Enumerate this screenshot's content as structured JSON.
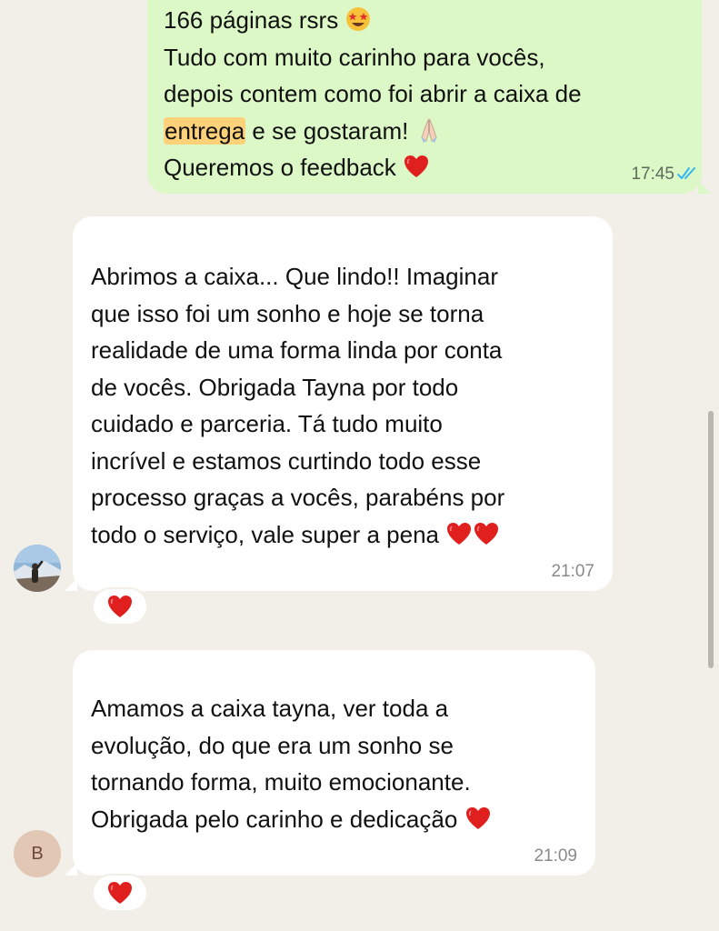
{
  "outgoing_message": {
    "lines": [
      {
        "text": "166 páginas rsrs ",
        "emoji": "star-struck-emoji"
      },
      {
        "text": "Tudo com muito carinho para vocês,"
      },
      {
        "text": "depois contem como foi abrir a caixa de"
      },
      {
        "highlight": "entrega",
        "text": " e se gostaram! ",
        "emoji": "folded-hands-emoji"
      },
      {
        "text": "Queremos o feedback ",
        "emoji": "red-heart-emoji"
      }
    ],
    "time": "17:45",
    "status_icon": "double-check-read-icon"
  },
  "incoming_messages": [
    {
      "lines": [
        "Abrimos a caixa... Que lindo!! Imaginar",
        "que isso foi um sonho e hoje se torna",
        "realidade de uma forma linda por conta",
        "de vocês. Obrigada Tayna por todo",
        "cuidado e parceria. Tá tudo muito",
        "incrível e estamos curtindo todo esse",
        "processo graças a vocês, parabéns por",
        "todo o serviço, vale super a pena "
      ],
      "trailing_emojis": [
        "red-heart-emoji",
        "red-heart-emoji"
      ],
      "time": "21:07",
      "reaction": "red-heart-emoji",
      "avatar": "photo-avatar"
    },
    {
      "lines": [
        "Amamos a caixa tayna, ver toda a",
        "evolução, do que era um sonho se",
        "tornando forma, muito emocionante.",
        "Obrigada pelo carinho e dedicação "
      ],
      "trailing_emojis": [
        "red-heart-emoji"
      ],
      "time": "21:09",
      "reaction": "red-heart-emoji",
      "avatar_initial": "B"
    }
  ],
  "colors": {
    "chat_background": "#f2efe8",
    "outgoing_bubble": "#dcf8c6",
    "incoming_bubble": "#ffffff",
    "highlight": "#ffd27a",
    "read_checks": "#34b7f1"
  }
}
